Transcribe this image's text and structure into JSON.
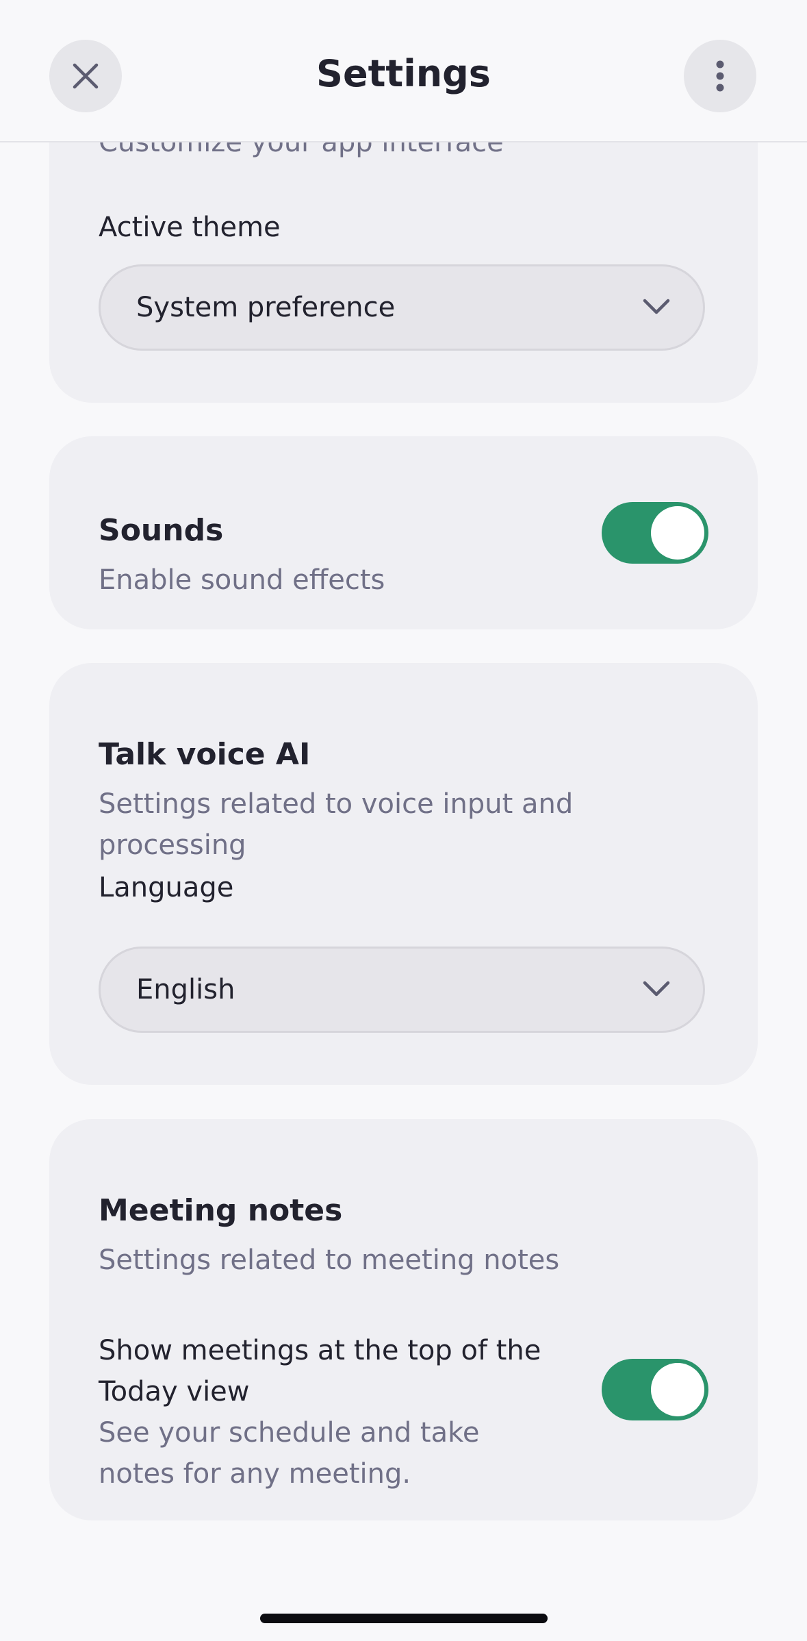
{
  "header": {
    "title": "Settings",
    "close_icon": "close-icon",
    "more_icon": "more-vertical-icon"
  },
  "appearance": {
    "description": "Customize your app interface",
    "theme_label": "Active theme",
    "theme_value": "System preference"
  },
  "sounds": {
    "title": "Sounds",
    "description": "Enable sound effects",
    "enabled": true
  },
  "voice": {
    "title": "Talk voice AI",
    "description": "Settings related to voice input and processing",
    "language_label": "Language",
    "language_value": "English"
  },
  "meetings": {
    "title": "Meeting notes",
    "description": "Settings related to meeting notes",
    "setting_title": "Show meetings at the top of the Today view",
    "setting_desc": "See your schedule and take notes for any meeting.",
    "enabled": true
  },
  "colors": {
    "toggle_on": "#2a946b",
    "card_bg": "#efeff3",
    "page_bg": "#f8f8fa"
  }
}
